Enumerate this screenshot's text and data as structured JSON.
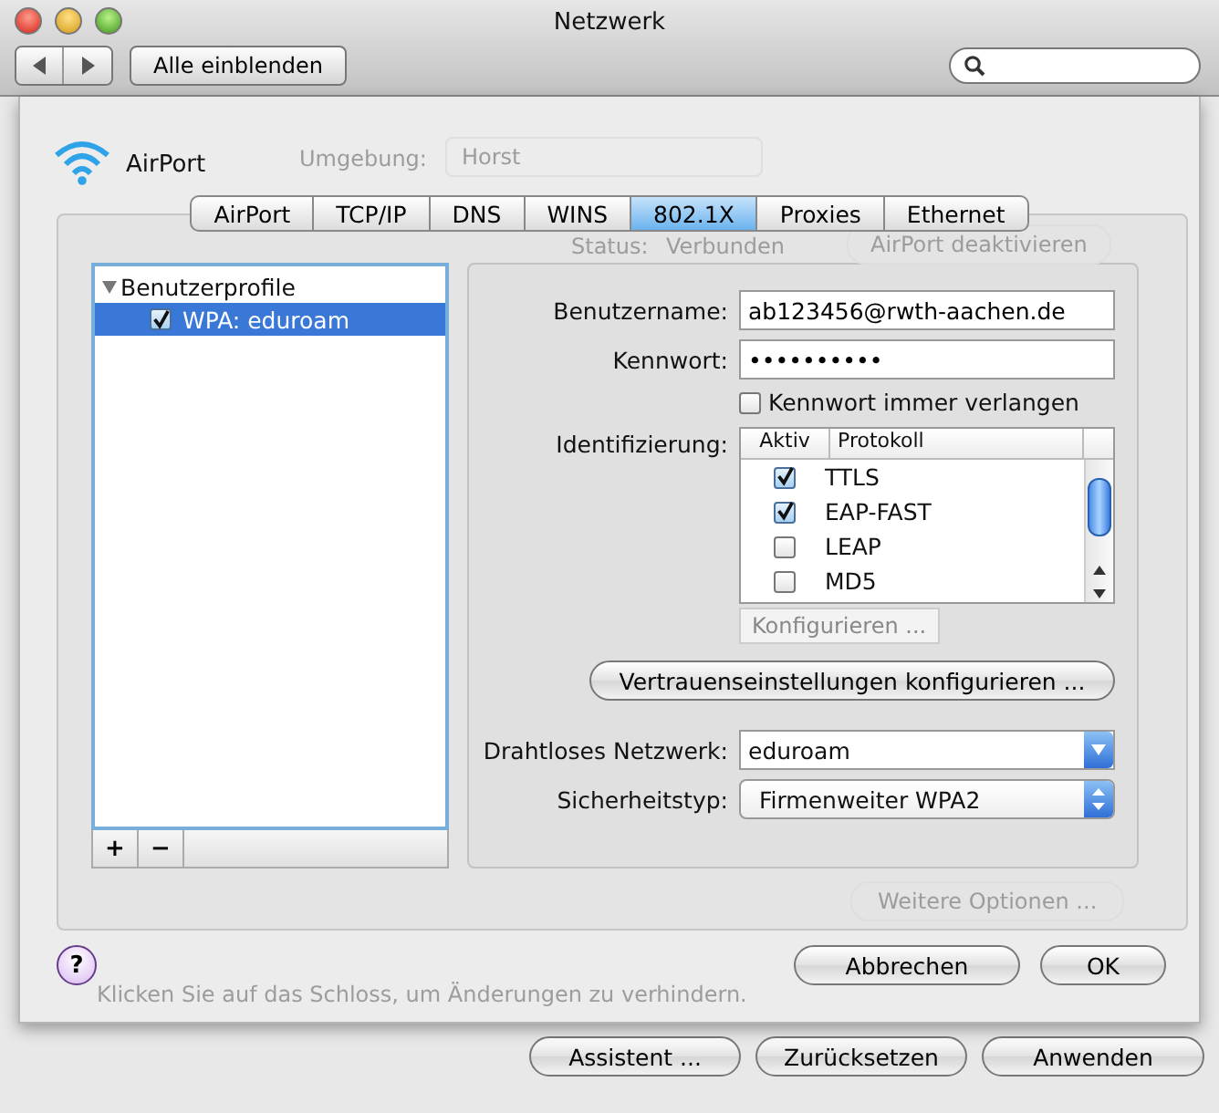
{
  "window": {
    "title": "Netzwerk"
  },
  "toolbar": {
    "show_all": "Alle einblenden"
  },
  "service": {
    "name": "AirPort"
  },
  "background": {
    "location_label": "Umgebung:",
    "location": "Horst",
    "status_label": "Status:",
    "status": "Verbunden",
    "toggle": "AirPort deaktivieren",
    "more": "Weitere Optionen ...",
    "lock_hint": "Klicken Sie auf das Schloss, um Änderungen zu verhindern."
  },
  "tabs": [
    {
      "label": "AirPort",
      "selected": false
    },
    {
      "label": "TCP/IP",
      "selected": false
    },
    {
      "label": "DNS",
      "selected": false
    },
    {
      "label": "WINS",
      "selected": false
    },
    {
      "label": "802.1X",
      "selected": true
    },
    {
      "label": "Proxies",
      "selected": false
    },
    {
      "label": "Ethernet",
      "selected": false
    }
  ],
  "profiles": {
    "group": "Benutzerprofile",
    "expanded": true,
    "add": "+",
    "remove": "−",
    "items": [
      {
        "label": "WPA: eduroam",
        "checked": true,
        "selected": true
      }
    ]
  },
  "form": {
    "username_label": "Benutzername:",
    "username": "ab123456@rwth-aachen.de",
    "password_label": "Kennwort:",
    "password": "••••••••••",
    "always_ask": {
      "label": "Kennwort immer verlangen",
      "checked": false
    },
    "auth_label": "Identifizierung:",
    "columns": [
      "Aktiv",
      "Protokoll"
    ],
    "protocols": [
      {
        "name": "TTLS",
        "checked": true
      },
      {
        "name": "EAP-FAST",
        "checked": true
      },
      {
        "name": "LEAP",
        "checked": false
      },
      {
        "name": "MD5",
        "checked": false
      }
    ],
    "configure": {
      "label": "Konfigurieren ...",
      "disabled": true
    },
    "trust": "Vertrauenseinstellungen konfigurieren ...",
    "network_label": "Drahtloses Netzwerk:",
    "network": "eduroam",
    "security_label": "Sicherheitstyp:",
    "security": "Firmenweiter WPA2"
  },
  "sheet_buttons": {
    "help": "?",
    "cancel": "Abbrechen",
    "ok": "OK"
  },
  "buttons": [
    "Assistent ...",
    "Zurücksetzen",
    "Anwenden"
  ]
}
